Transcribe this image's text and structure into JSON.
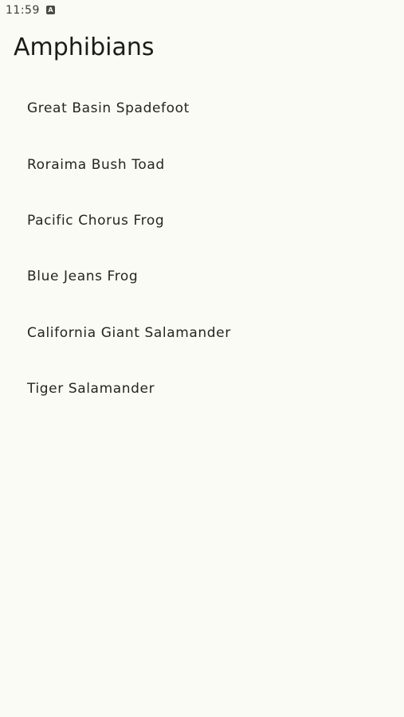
{
  "status_bar": {
    "time": "11:59",
    "notification_icon_letter": "A",
    "notification_icon_name": "app-notification-icon"
  },
  "app_bar": {
    "title": "Amphibians"
  },
  "amphibians": [
    {
      "name": "Great Basin Spadefoot"
    },
    {
      "name": "Roraima Bush Toad"
    },
    {
      "name": "Pacific Chorus Frog"
    },
    {
      "name": "Blue Jeans Frog"
    },
    {
      "name": "California Giant Salamander"
    },
    {
      "name": "Tiger Salamander"
    }
  ],
  "colors": {
    "background": "#fbfbf5",
    "text_primary": "#1b1c18",
    "status_text": "#3a3b36"
  }
}
